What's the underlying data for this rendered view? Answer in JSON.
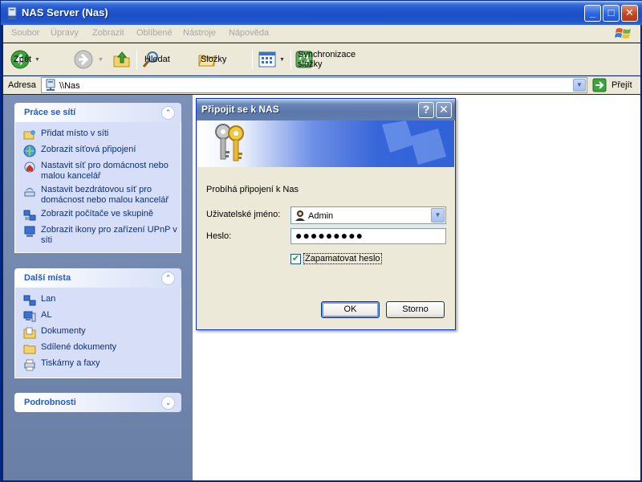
{
  "window": {
    "title": "NAS Server (Nas)",
    "minimize_glyph": "_",
    "maximize_glyph": "□",
    "close_glyph": "✕"
  },
  "menubar": {
    "items": [
      "Soubor",
      "Úpravy",
      "Zobrazit",
      "Oblíbené",
      "Nástroje",
      "Nápověda"
    ]
  },
  "toolbar": {
    "back_label": "Zpět",
    "search_label": "Hledat",
    "folders_label": "Složky",
    "sync_label": "Synchronizace složky"
  },
  "addressbar": {
    "label": "Adresa",
    "value": "\\\\Nas",
    "go_label": "Přejít"
  },
  "leftpane": {
    "network_tasks": {
      "title": "Práce se sítí",
      "chevron": "⌃",
      "items": [
        {
          "label": "Přidat místo v síti",
          "icon": "add-network-place-icon"
        },
        {
          "label": "Zobrazit síťová připojení",
          "icon": "network-connections-icon"
        },
        {
          "label": "Nastavit síť pro domácnost nebo malou kancelář",
          "icon": "home-network-icon"
        },
        {
          "label": "Nastavit bezdrátovou síť pro domácnost nebo malou kancelář",
          "icon": "wireless-network-icon"
        },
        {
          "label": "Zobrazit počítače ve skupině",
          "icon": "workgroup-computers-icon"
        },
        {
          "label": "Zobrazit ikony pro zařízení UPnP v síti",
          "icon": "upnp-icon"
        }
      ]
    },
    "other_places": {
      "title": "Další místa",
      "chevron": "⌃",
      "items": [
        {
          "label": "Lan",
          "icon": "network-icon"
        },
        {
          "label": "AL",
          "icon": "computer-icon"
        },
        {
          "label": "Dokumenty",
          "icon": "documents-folder-icon"
        },
        {
          "label": "Sdílené dokumenty",
          "icon": "shared-folder-icon"
        },
        {
          "label": "Tiskárny a faxy",
          "icon": "printer-icon"
        }
      ]
    },
    "details": {
      "title": "Podrobnosti",
      "chevron": "⌄"
    }
  },
  "dialog": {
    "title": "Připojit se k NAS",
    "help_glyph": "?",
    "close_glyph": "✕",
    "status_text": "Probíhá připojení k Nas",
    "username_label": "Uživatelské jméno:",
    "username_value": "Admin",
    "password_label": "Heslo:",
    "password_mask": "●●●●●●●●●",
    "remember_label": "Zapamatovat heslo",
    "remember_checked": true,
    "ok_label": "OK",
    "cancel_label": "Storno"
  }
}
